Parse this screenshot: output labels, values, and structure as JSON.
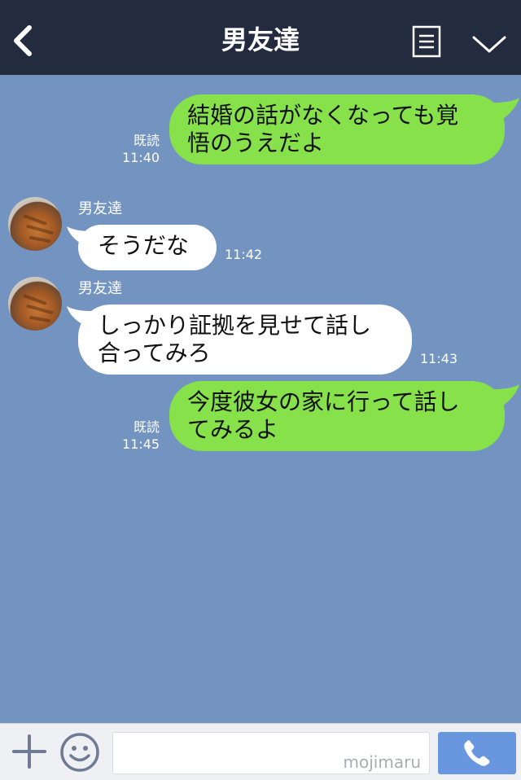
{
  "header": {
    "title": "男友達",
    "back_icon": "chevron-left-icon",
    "notes_icon": "notes-icon",
    "menu_icon": "chevron-down-icon",
    "bg_color": "#232b3f"
  },
  "chat": {
    "bg_color": "#7393c1",
    "messages": [
      {
        "from": "me",
        "text": "結婚の話がなくなっても覚\n悟のうえだよ",
        "read": "既読",
        "time": "11:40"
      },
      {
        "from": "them",
        "sender": "男友達",
        "text": "そうだな",
        "time": "11:42"
      },
      {
        "from": "them",
        "sender": "男友達",
        "text": "しっかり証拠を見せて話し\n合ってみろ",
        "time": "11:43"
      },
      {
        "from": "me",
        "text": "今度彼女の家に行って話し\nてみるよ",
        "read": "既読",
        "time": "11:45"
      }
    ],
    "my_bubble_color": "#86e14b",
    "their_bubble_color": "#ffffff"
  },
  "composer": {
    "plus_icon": "plus-icon",
    "emoji_icon": "emoji-icon",
    "input_value": "",
    "watermark": "mojimaru",
    "call_icon": "phone-icon",
    "call_button_color": "#6897e0"
  }
}
